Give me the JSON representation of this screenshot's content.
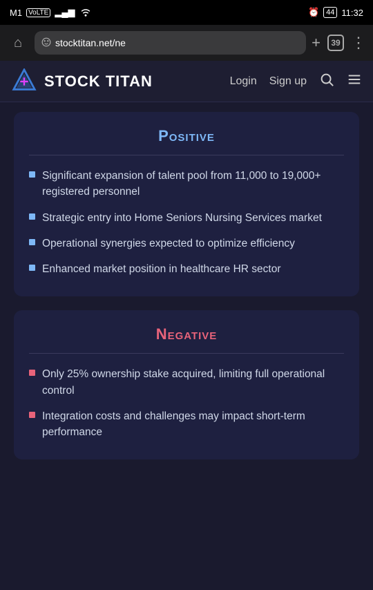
{
  "statusBar": {
    "carrier": "M1",
    "carrierType": "VoLTE",
    "signal": "●●●",
    "wifi": "wifi",
    "alarmIcon": "⏰",
    "battery": "44",
    "time": "11:32"
  },
  "browserBar": {
    "addressText": "stocktitan.net/ne",
    "tabCount": "39",
    "newTabLabel": "+",
    "moreLabel": "⋮"
  },
  "siteHeader": {
    "title": "STOCK TITAN",
    "loginLabel": "Login",
    "signupLabel": "Sign up"
  },
  "positive": {
    "title": "Positive",
    "bullets": [
      "Significant expansion of talent pool from 11,000 to 19,000+ registered personnel",
      "Strategic entry into Home Seniors Nursing Services market",
      "Operational synergies expected to optimize efficiency",
      "Enhanced market position in healthcare HR sector"
    ]
  },
  "negative": {
    "title": "Negative",
    "bullets": [
      "Only 25% ownership stake acquired, limiting full operational control",
      "Integration costs and challenges may impact short-term performance"
    ]
  }
}
